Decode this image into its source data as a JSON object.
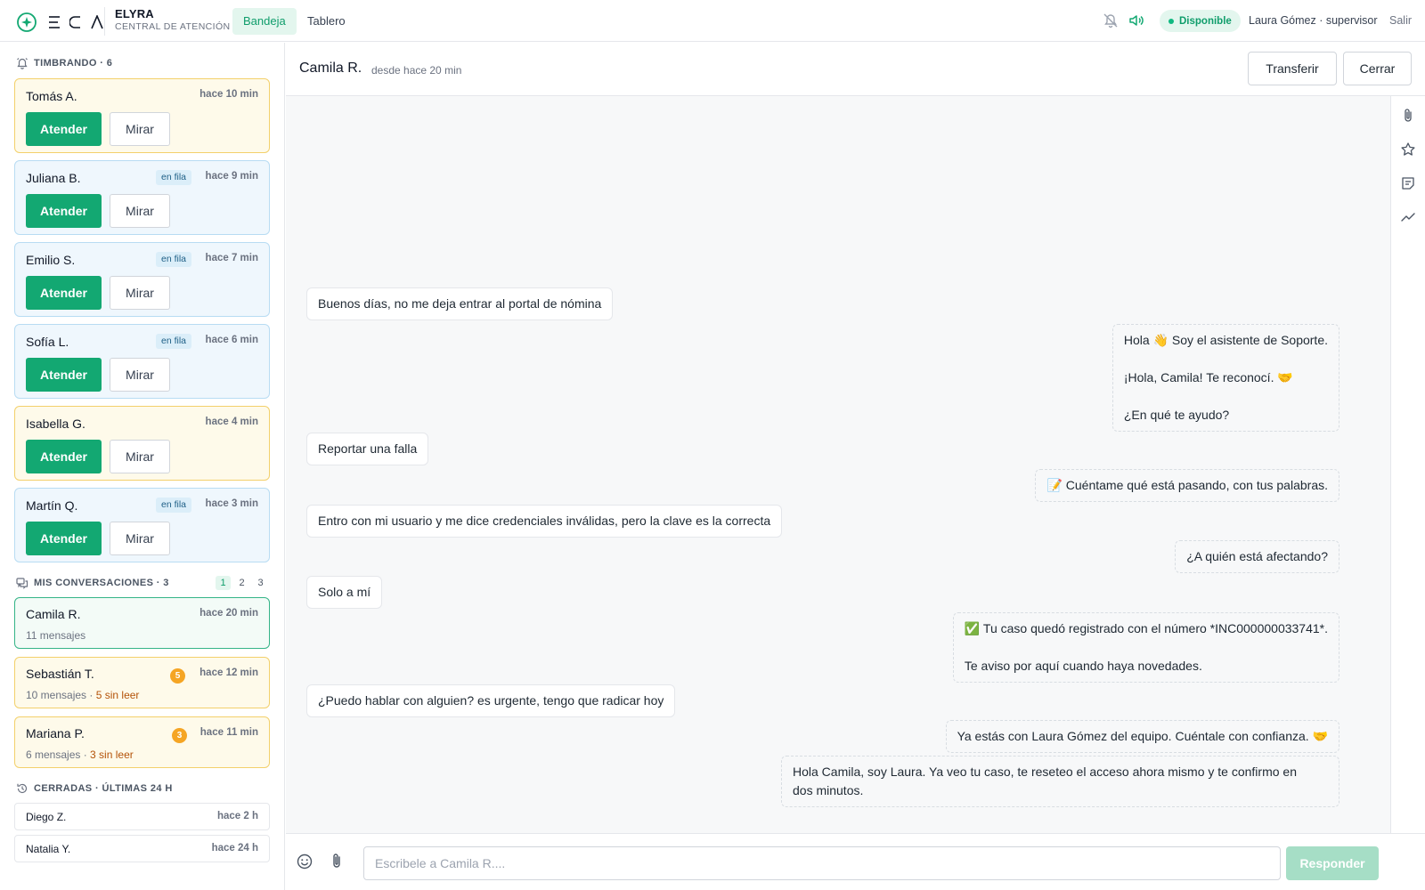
{
  "app": {
    "logo_letters": [
      "E",
      "C",
      "A"
    ],
    "brand_name": "ELYRA",
    "brand_sub": "CENTRAL DE ATENCIÓN"
  },
  "nav": {
    "tabs": [
      {
        "label": "Bandeja",
        "active": true
      },
      {
        "label": "Tablero",
        "active": false
      }
    ]
  },
  "topbar": {
    "icons": [
      "bell-off-icon",
      "speaker-icon"
    ],
    "status": "Disponible",
    "user": "Laura Gómez · supervisor",
    "logout": "Salir"
  },
  "sidebar": {
    "ringing": {
      "title": "TIMBRANDO · 6",
      "action_label": "Atender",
      "watch_label": "Mirar",
      "items": [
        {
          "name": "Tomás A.",
          "time": "hace 10 min",
          "tag": "",
          "color": "yellow"
        },
        {
          "name": "Juliana B.",
          "time": "hace 9 min",
          "tag": "en fila",
          "color": "blue"
        },
        {
          "name": "Emilio S.",
          "time": "hace 7 min",
          "tag": "en fila",
          "color": "blue"
        },
        {
          "name": "Sofía L.",
          "time": "hace 6 min",
          "tag": "en fila",
          "color": "blue"
        },
        {
          "name": "Isabella G.",
          "time": "hace 4 min",
          "tag": "",
          "color": "yellow"
        },
        {
          "name": "Martín Q.",
          "time": "hace 3 min",
          "tag": "en fila",
          "color": "blue"
        }
      ]
    },
    "mine": {
      "title": "MIS CONVERSACIONES · 3",
      "pages": [
        "1",
        "2",
        "3"
      ],
      "active_page": "1",
      "items": [
        {
          "name": "Camila R.",
          "time": "hace 20 min",
          "messages": "11 mensajes",
          "unread": "",
          "count": "",
          "color": "green"
        },
        {
          "name": "Sebastián T.",
          "time": "hace 12 min",
          "messages": "10 mensajes",
          "unread": "5 sin leer",
          "count": "5",
          "color": "yellow"
        },
        {
          "name": "Mariana P.",
          "time": "hace 11 min",
          "messages": "6 mensajes",
          "unread": "3 sin leer",
          "count": "3",
          "color": "yellow"
        }
      ]
    },
    "closed": {
      "title": "CERRADAS · ÚLTIMAS 24 H",
      "items": [
        {
          "name": "Diego Z.",
          "time": "hace 2 h"
        },
        {
          "name": "Natalia Y.",
          "time": "hace 24 h"
        }
      ]
    }
  },
  "conversation": {
    "contact": "Camila R.",
    "since": "desde hace 20 min",
    "transfer_label": "Transferir",
    "close_label": "Cerrar",
    "rail_icons": [
      "paperclip-icon",
      "star-icon",
      "note-icon",
      "trend-icon"
    ],
    "messages": [
      {
        "dir": "in",
        "lines": [
          "Buenos días, no me deja entrar al portal de nómina"
        ]
      },
      {
        "dir": "out",
        "lines": [
          "Hola 👋 Soy el asistente de Soporte.",
          "",
          "¡Hola, Camila! Te reconocí. 🤝",
          "",
          "¿En qué te ayudo?"
        ]
      },
      {
        "dir": "in",
        "lines": [
          "Reportar una falla"
        ]
      },
      {
        "dir": "out",
        "lines": [
          "📝 Cuéntame qué está pasando, con tus palabras."
        ]
      },
      {
        "dir": "in",
        "lines": [
          "Entro con mi usuario y me dice credenciales inválidas, pero la clave es la correcta"
        ]
      },
      {
        "dir": "out",
        "lines": [
          "¿A quién está afectando?"
        ]
      },
      {
        "dir": "in",
        "lines": [
          "Solo a mí"
        ]
      },
      {
        "dir": "out",
        "lines": [
          "✅ Tu caso quedó registrado con el número *INC000000033741*.",
          "",
          "Te aviso por aquí cuando haya novedades."
        ]
      },
      {
        "dir": "in",
        "lines": [
          "¿Puedo hablar con alguien? es urgente, tengo que radicar hoy"
        ]
      },
      {
        "dir": "out",
        "lines": [
          "Ya estás con Laura Gómez del equipo. Cuéntale con confianza. 🤝"
        ]
      },
      {
        "dir": "out",
        "lines": [
          "Hola Camila, soy Laura. Ya veo tu caso, te reseteo el acceso ahora mismo y te confirmo en",
          "dos minutos."
        ]
      }
    ]
  },
  "composer": {
    "placeholder": "Escribele a Camila R....",
    "value": "",
    "send_label": "Responder",
    "icons": [
      "emoji-icon",
      "paperclip-icon"
    ]
  },
  "colors": {
    "accent": "#13a872",
    "accent_soft": "#e3f6ee",
    "ringing_yellow_bg": "#fefaea",
    "queue_blue_bg": "#eff7fd",
    "unread_badge": "#f5a524"
  }
}
